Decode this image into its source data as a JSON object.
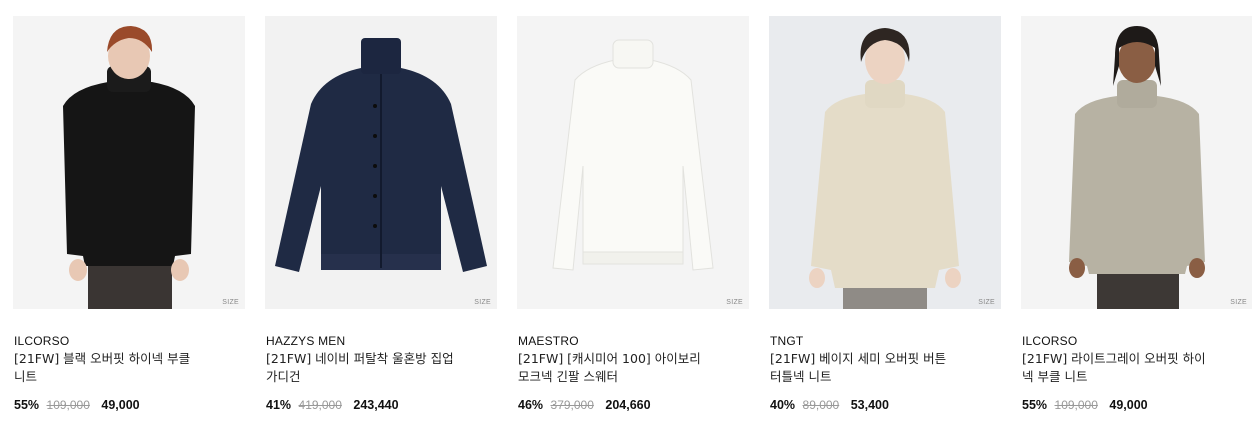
{
  "products": [
    {
      "brand": "ILCORSO",
      "name": "[21FW] 블랙 오버핏 하이넥 부클\n니트",
      "discount": "55%",
      "original_price": "109,000",
      "price": "49,000",
      "size_label": "SIZE"
    },
    {
      "brand": "HAZZYS MEN",
      "name": "[21FW] 네이비 퍼탈착 울혼방 집업\n가디건",
      "discount": "41%",
      "original_price": "419,000",
      "price": "243,440",
      "size_label": "SIZE"
    },
    {
      "brand": "MAESTRO",
      "name": "[21FW] [캐시미어 100] 아이보리\n모크넥 긴팔 스웨터",
      "discount": "46%",
      "original_price": "379,000",
      "price": "204,660",
      "size_label": "SIZE"
    },
    {
      "brand": "TNGT",
      "name": "[21FW] 베이지 세미 오버핏 버튼\n터틀넥 니트",
      "discount": "40%",
      "original_price": "89,000",
      "price": "53,400",
      "size_label": "SIZE"
    },
    {
      "brand": "ILCORSO",
      "name": "[21FW] 라이트그레이 오버핏 하이\n넥 부클 니트",
      "discount": "55%",
      "original_price": "109,000",
      "price": "49,000",
      "size_label": "SIZE"
    }
  ]
}
